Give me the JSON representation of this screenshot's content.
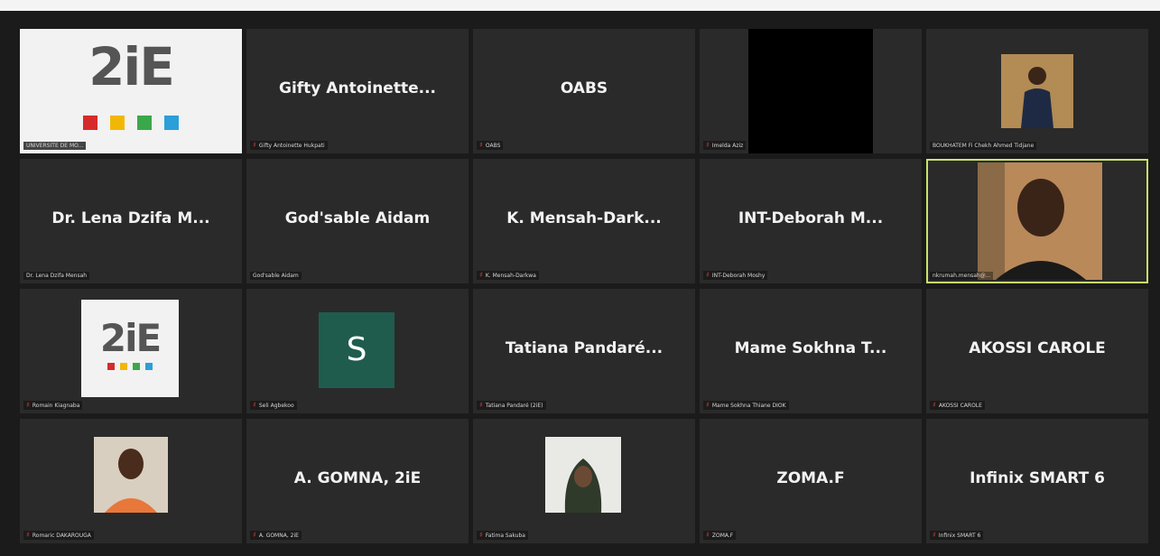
{
  "app": "Video meeting gallery view",
  "logo": {
    "text": "2iE",
    "colors": [
      "#d62b2b",
      "#f2b705",
      "#3aa84a",
      "#2b9fd9"
    ]
  },
  "tiles": [
    {
      "display": "",
      "label": "UNIVERSITE DE MO..."
    },
    {
      "display": "Gifty Antoinette...",
      "label": "Gifty Antoinette Hukpati"
    },
    {
      "display": "OABS",
      "label": "OABS"
    },
    {
      "display": "",
      "label": "Imelda Aziz"
    },
    {
      "display": "",
      "label": "BOUKHATEM Fi Chekh Ahmed Tidjane"
    },
    {
      "display": "Dr. Lena Dzifa M...",
      "label": "Dr. Lena Dzifa Mensah"
    },
    {
      "display": "God'sable Aidam",
      "label": "God'sable Aidam"
    },
    {
      "display": "K. Mensah-Dark...",
      "label": "K. Mensah-Darkwa"
    },
    {
      "display": "INT-Deborah M...",
      "label": "INT-Deborah Moshy"
    },
    {
      "display": "",
      "label": "nkrumah.mensah@..."
    },
    {
      "display": "",
      "label": "Romain Kiagnaba"
    },
    {
      "display": "S",
      "label": "Seli Agbekoo"
    },
    {
      "display": "Tatiana Pandaré...",
      "label": "Tatiana Pandaré (2iE)"
    },
    {
      "display": "Mame Sokhna T...",
      "label": "Mame Sokhna Thiane DIOK"
    },
    {
      "display": "AKOSSI CAROLE",
      "label": "AKOSSI CAROLE"
    },
    {
      "display": "",
      "label": "Romaric DAKAROUGA"
    },
    {
      "display": "A. GOMNA, 2iE",
      "label": "A. GOMNA, 2iE"
    },
    {
      "display": "",
      "label": "Fatima Sakuba"
    },
    {
      "display": "ZOMA.F",
      "label": "ZOMA.F"
    },
    {
      "display": "Infinix SMART 6",
      "label": "Infinix SMART 6"
    }
  ],
  "colors": {
    "active_speaker": "#c9e36b",
    "muted": "#e03a3a",
    "avatar_bg": "#1f5c4e"
  }
}
